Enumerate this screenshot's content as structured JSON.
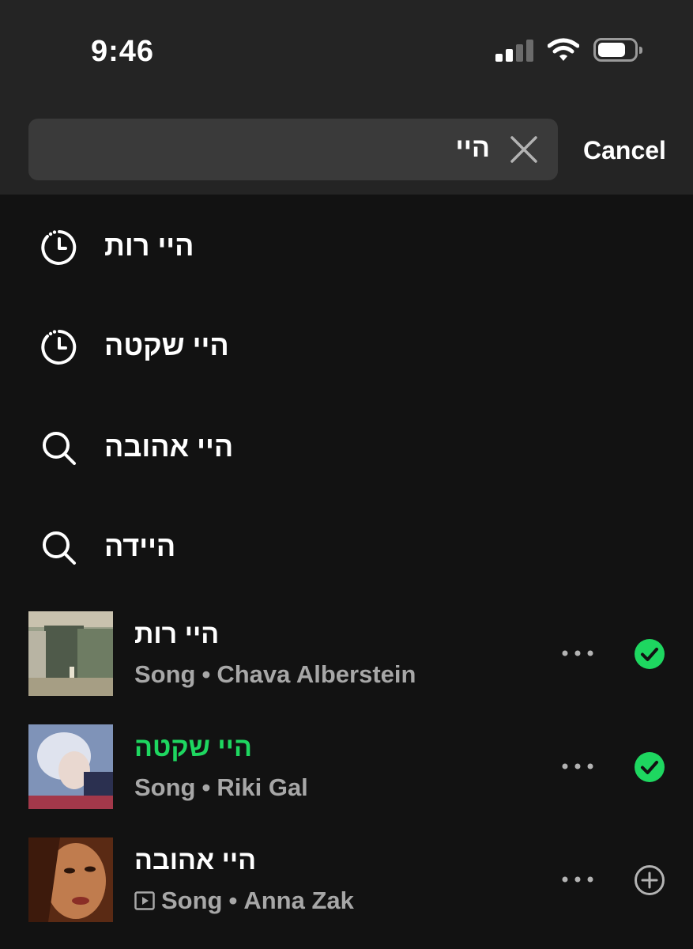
{
  "status_bar": {
    "time": "9:46"
  },
  "search": {
    "query": "היי",
    "cancel_label": "Cancel"
  },
  "suggestions": [
    {
      "label": "היי רות",
      "icon": "history-icon"
    },
    {
      "label": "היי שקטה",
      "icon": "history-icon"
    },
    {
      "label": "היי אהובה",
      "icon": "search-icon"
    },
    {
      "label": "היידה",
      "icon": "search-icon"
    }
  ],
  "tracks": [
    {
      "title": "היי רות",
      "type": "Song",
      "separator": "•",
      "artist": "Chava Alberstein",
      "status": "added",
      "active": false
    },
    {
      "title": "היי שקטה",
      "type": "Song",
      "separator": "•",
      "artist": "Riki Gal",
      "status": "added",
      "active": true
    },
    {
      "title": "היי אהובה",
      "type": "Song",
      "separator": "•",
      "artist": "Anna Zak",
      "status": "add",
      "active": false,
      "video": true
    }
  ],
  "colors": {
    "accent": "#1ed760",
    "background": "#121212",
    "header": "#242424",
    "subtext": "#a7a7a7"
  }
}
